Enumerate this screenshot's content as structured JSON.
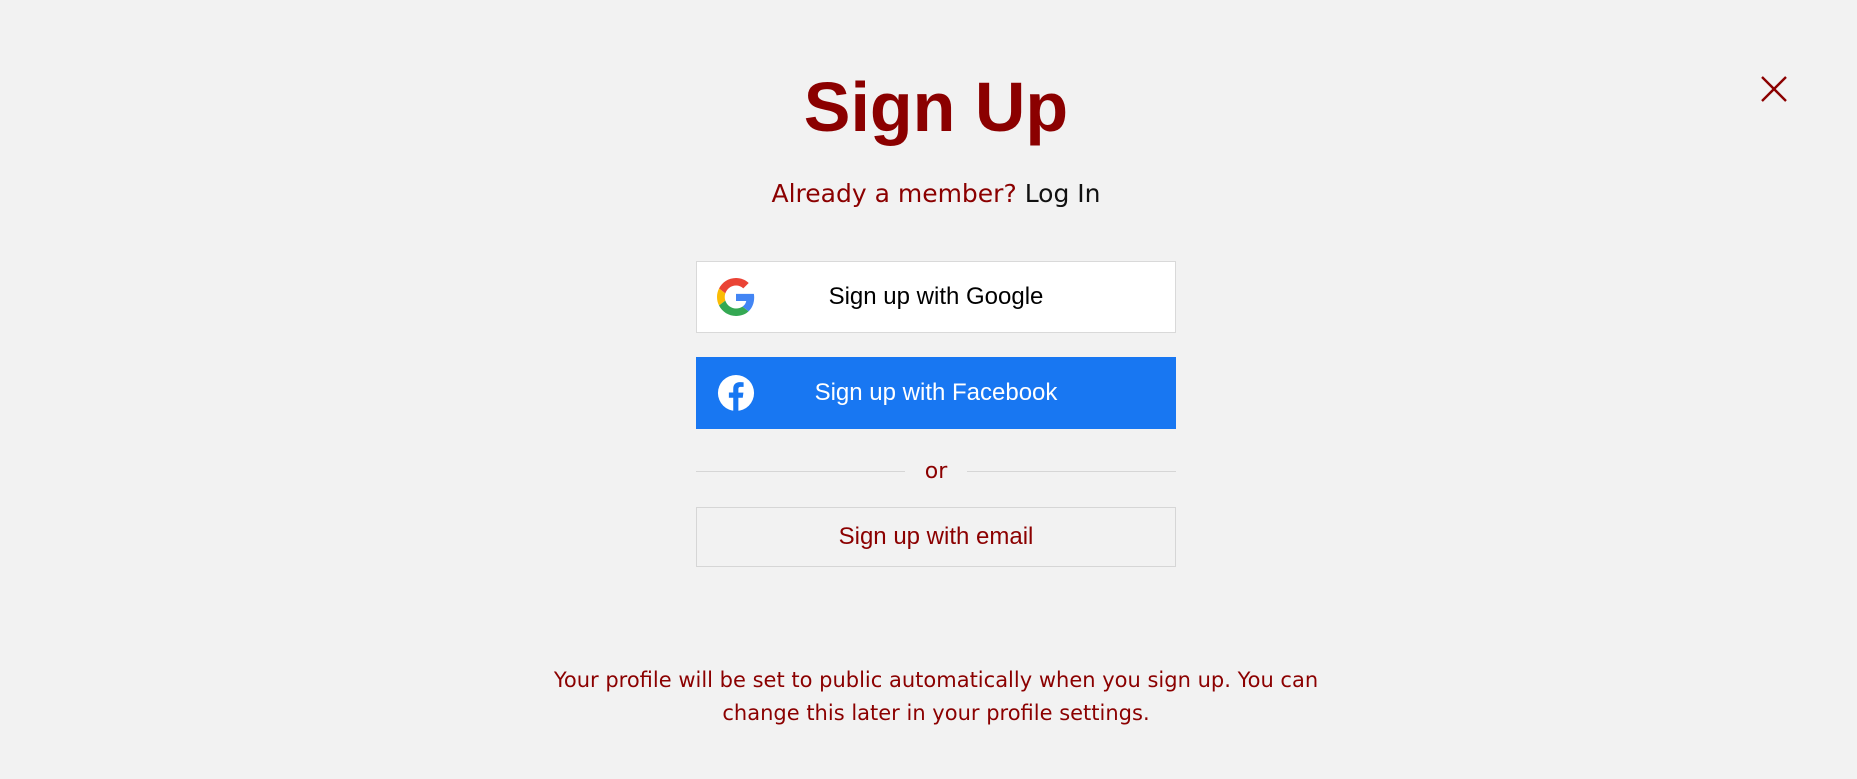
{
  "dialog": {
    "title": "Sign Up",
    "close_icon": "close-icon",
    "member_prompt": "Already a member?",
    "login_link": "Log In",
    "google_button": {
      "label": "Sign up with Google",
      "icon": "google-icon"
    },
    "facebook_button": {
      "label": "Sign up with Facebook",
      "icon": "facebook-icon"
    },
    "divider_text": "or",
    "email_button": {
      "label": "Sign up with email"
    },
    "footer_note": "Your profile will be set to public automatically when you sign up. You can change this later in your profile settings."
  },
  "colors": {
    "background": "#f2f2f2",
    "accent": "#8b0000",
    "facebook_blue": "#1877f2",
    "link_text": "#111111"
  }
}
